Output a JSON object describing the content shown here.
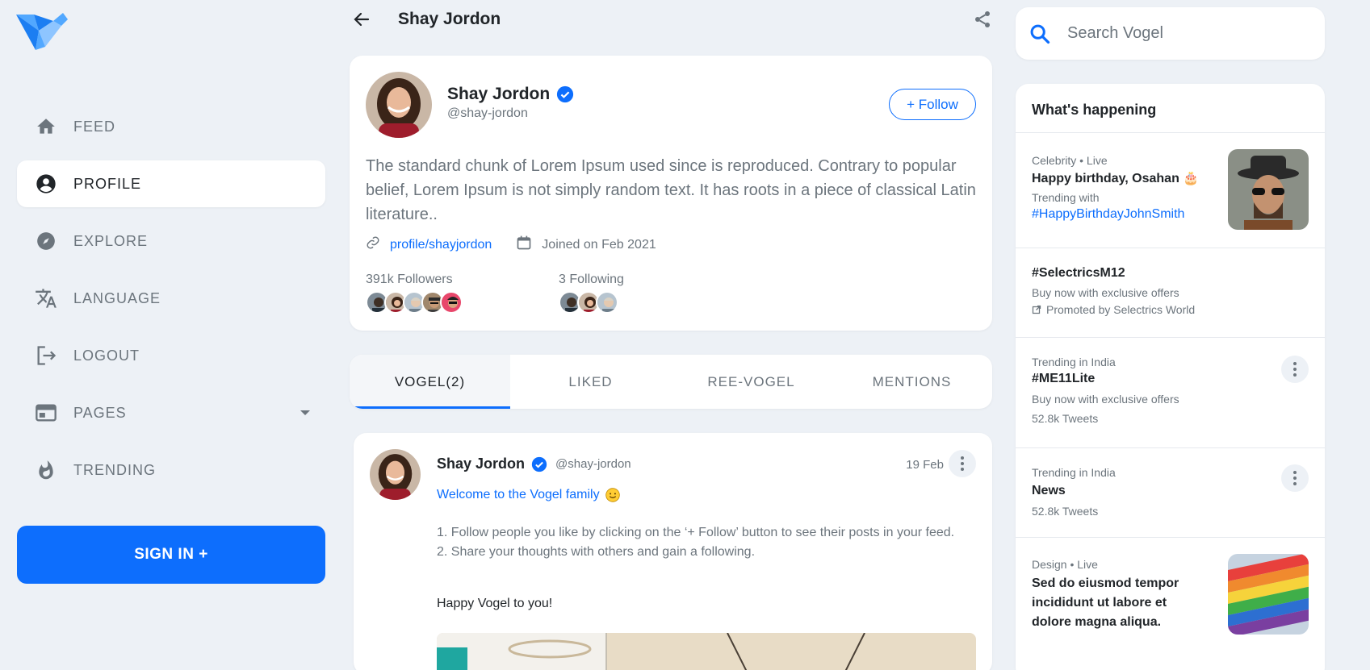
{
  "nav": {
    "items": [
      {
        "label": "FEED",
        "icon": "home-icon"
      },
      {
        "label": "PROFILE",
        "icon": "account-circle-icon"
      },
      {
        "label": "EXPLORE",
        "icon": "compass-icon"
      },
      {
        "label": "LANGUAGE",
        "icon": "translate-icon"
      },
      {
        "label": "LOGOUT",
        "icon": "logout-icon"
      },
      {
        "label": "PAGES",
        "icon": "web-page-icon"
      },
      {
        "label": "TRENDING",
        "icon": "fire-icon"
      }
    ],
    "active": "PROFILE",
    "signin_label": "SIGN IN +"
  },
  "header": {
    "title": "Shay Jordon"
  },
  "profile": {
    "name": "Shay Jordon",
    "handle": "@shay-jordon",
    "follow_label": "+ Follow",
    "bio": "The standard chunk of Lorem Ipsum used since is reproduced. Contrary to popular belief, Lorem Ipsum is not simply random text. It has roots in a piece of classical Latin literature..",
    "link": "profile/shayjordon",
    "joined": "Joined on Feb 2021",
    "followers": "391k Followers",
    "following": "3 Following"
  },
  "tabs": [
    "VOGEL(2)",
    "LIKED",
    "REE-VOGEL",
    "MENTIONS"
  ],
  "post": {
    "name": "Shay Jordon",
    "handle": "@shay-jordon",
    "date": "19 Feb",
    "headline": "Welcome to the Vogel family",
    "line1": "1. Follow people you like by clicking on the ‘+ Follow’ button to see their posts in your feed.",
    "line2": "2. Share your thoughts with others and gain a following.",
    "closing": "Happy Vogel to you!"
  },
  "search": {
    "placeholder": "Search Vogel"
  },
  "trends": {
    "title": "What's happening",
    "items": [
      {
        "meta": "Celebrity • Live",
        "title": "Happy birthday, Osahan 🎂",
        "sub": "Trending with",
        "tag": "#HappyBirthdayJohnSmith"
      },
      {
        "title": "#SelectricsM12",
        "sub": "Buy now with exclusive offers",
        "promo": "Promoted by Selectrics World"
      },
      {
        "meta": "Trending in India",
        "title": "#ME11Lite",
        "sub": "Buy now with exclusive offers",
        "count": "52.8k Tweets"
      },
      {
        "meta": "Trending in India",
        "title": "News",
        "count": "52.8k Tweets"
      },
      {
        "meta": "Design • Live",
        "title": "Sed do eiusmod tempor incididunt ut labore et dolore magna aliqua."
      }
    ]
  },
  "colors": {
    "accent": "#0d6efd",
    "background": "#edf1f6",
    "muted": "#6c757d"
  }
}
